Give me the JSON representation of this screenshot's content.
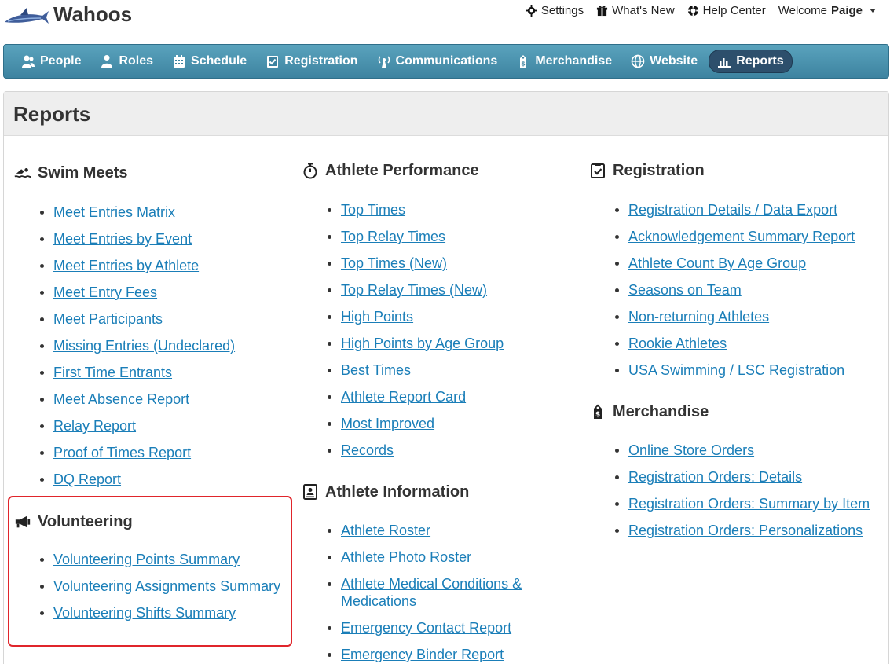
{
  "header": {
    "team_name": "Wahoos",
    "links": {
      "settings": "Settings",
      "whats_new": "What's New",
      "help_center": "Help Center",
      "welcome": "Welcome",
      "user": "Paige"
    }
  },
  "nav": {
    "people": "People",
    "roles": "Roles",
    "schedule": "Schedule",
    "registration": "Registration",
    "communications": "Communications",
    "merchandise": "Merchandise",
    "website": "Website",
    "reports": "Reports"
  },
  "page": {
    "title": "Reports"
  },
  "sections": {
    "swim_meets": {
      "title": "Swim Meets",
      "items": [
        "Meet Entries Matrix",
        "Meet Entries by Event",
        "Meet Entries by Athlete",
        "Meet Entry Fees",
        "Meet Participants",
        "Missing Entries (Undeclared)",
        "First Time Entrants",
        "Meet Absence Report",
        "Relay Report",
        "Proof of Times Report",
        "DQ Report"
      ]
    },
    "volunteering": {
      "title": "Volunteering",
      "items": [
        "Volunteering Points Summary",
        "Volunteering Assignments Summary",
        "Volunteering Shifts Summary"
      ]
    },
    "athlete_performance": {
      "title": "Athlete Performance",
      "items": [
        "Top Times",
        "Top Relay Times",
        "Top Times (New)",
        "Top Relay Times (New)",
        "High Points",
        "High Points by Age Group",
        "Best Times",
        "Athlete Report Card",
        "Most Improved",
        "Records"
      ]
    },
    "athlete_information": {
      "title": "Athlete Information",
      "items": [
        "Athlete Roster",
        "Athlete Photo Roster",
        "Athlete Medical Conditions & Medications",
        "Emergency Contact Report",
        "Emergency Binder Report"
      ]
    },
    "registration": {
      "title": "Registration",
      "items": [
        "Registration Details / Data Export",
        "Acknowledgement Summary Report",
        "Athlete Count By Age Group",
        "Seasons on Team",
        "Non-returning Athletes",
        "Rookie Athletes",
        "USA Swimming / LSC Registration"
      ]
    },
    "merchandise": {
      "title": "Merchandise",
      "items": [
        "Online Store Orders",
        "Registration Orders: Details",
        "Registration Orders: Summary by Item",
        "Registration Orders: Personalizations"
      ]
    }
  },
  "colors": {
    "link": "#1a7eb8",
    "nav_top": "#5aa3bd",
    "nav_bottom": "#3d83a0",
    "nav_active": "#2d4f6c",
    "highlight": "#e0252b"
  }
}
